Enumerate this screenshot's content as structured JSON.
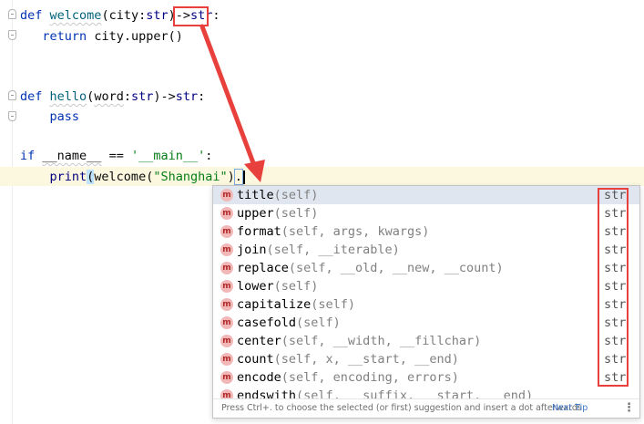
{
  "editor": {
    "line1": {
      "def": "def",
      "name": "welcome",
      "open": "(",
      "param": "city",
      "colon": ":",
      "ptype": "str",
      "close": ")",
      "arrow": "->",
      "rtype": "str",
      "end": ":"
    },
    "line2": {
      "return": "return",
      "obj": "city",
      "call": ".upper()"
    },
    "line3": {
      "def": "def",
      "name": "hello",
      "open": "(",
      "param": "word",
      "colon": ":",
      "ptype": "str",
      "close": ")",
      "arrow": "->",
      "rtype": "str",
      "end": ":"
    },
    "line4": {
      "pass": "pass"
    },
    "line5": {
      "if": "if",
      "dunder": "__name__",
      "op": " == ",
      "str": "'__main__'",
      "end": ":"
    },
    "line6": {
      "print": "print",
      "open": "(",
      "fn": "welcome",
      "open2": "(",
      "str": "\"Shanghai\"",
      "close": ")",
      "dot": "."
    }
  },
  "completion": {
    "items": [
      {
        "name": "title",
        "params": "(self)",
        "type": "str"
      },
      {
        "name": "upper",
        "params": "(self)",
        "type": "str"
      },
      {
        "name": "format",
        "params": "(self, args, kwargs)",
        "type": "str"
      },
      {
        "name": "join",
        "params": "(self, __iterable)",
        "type": "str"
      },
      {
        "name": "replace",
        "params": "(self, __old, __new, __count)",
        "type": "str"
      },
      {
        "name": "lower",
        "params": "(self)",
        "type": "str"
      },
      {
        "name": "capitalize",
        "params": "(self)",
        "type": "str"
      },
      {
        "name": "casefold",
        "params": "(self)",
        "type": "str"
      },
      {
        "name": "center",
        "params": "(self, __width, __fillchar)",
        "type": "str"
      },
      {
        "name": "count",
        "params": "(self, x, __start, __end)",
        "type": "str"
      },
      {
        "name": "encode",
        "params": "(self, encoding, errors)",
        "type": "str"
      },
      {
        "name": "endswith",
        "params": "(self, __suffix, __start, __end)",
        "type": ""
      }
    ],
    "badge": "m",
    "footer_hint": "Press Ctrl+. to choose the selected (or first) suggestion and insert a dot afterwards",
    "next_tip": "Next Tip",
    "menu_glyph": "⋮"
  }
}
